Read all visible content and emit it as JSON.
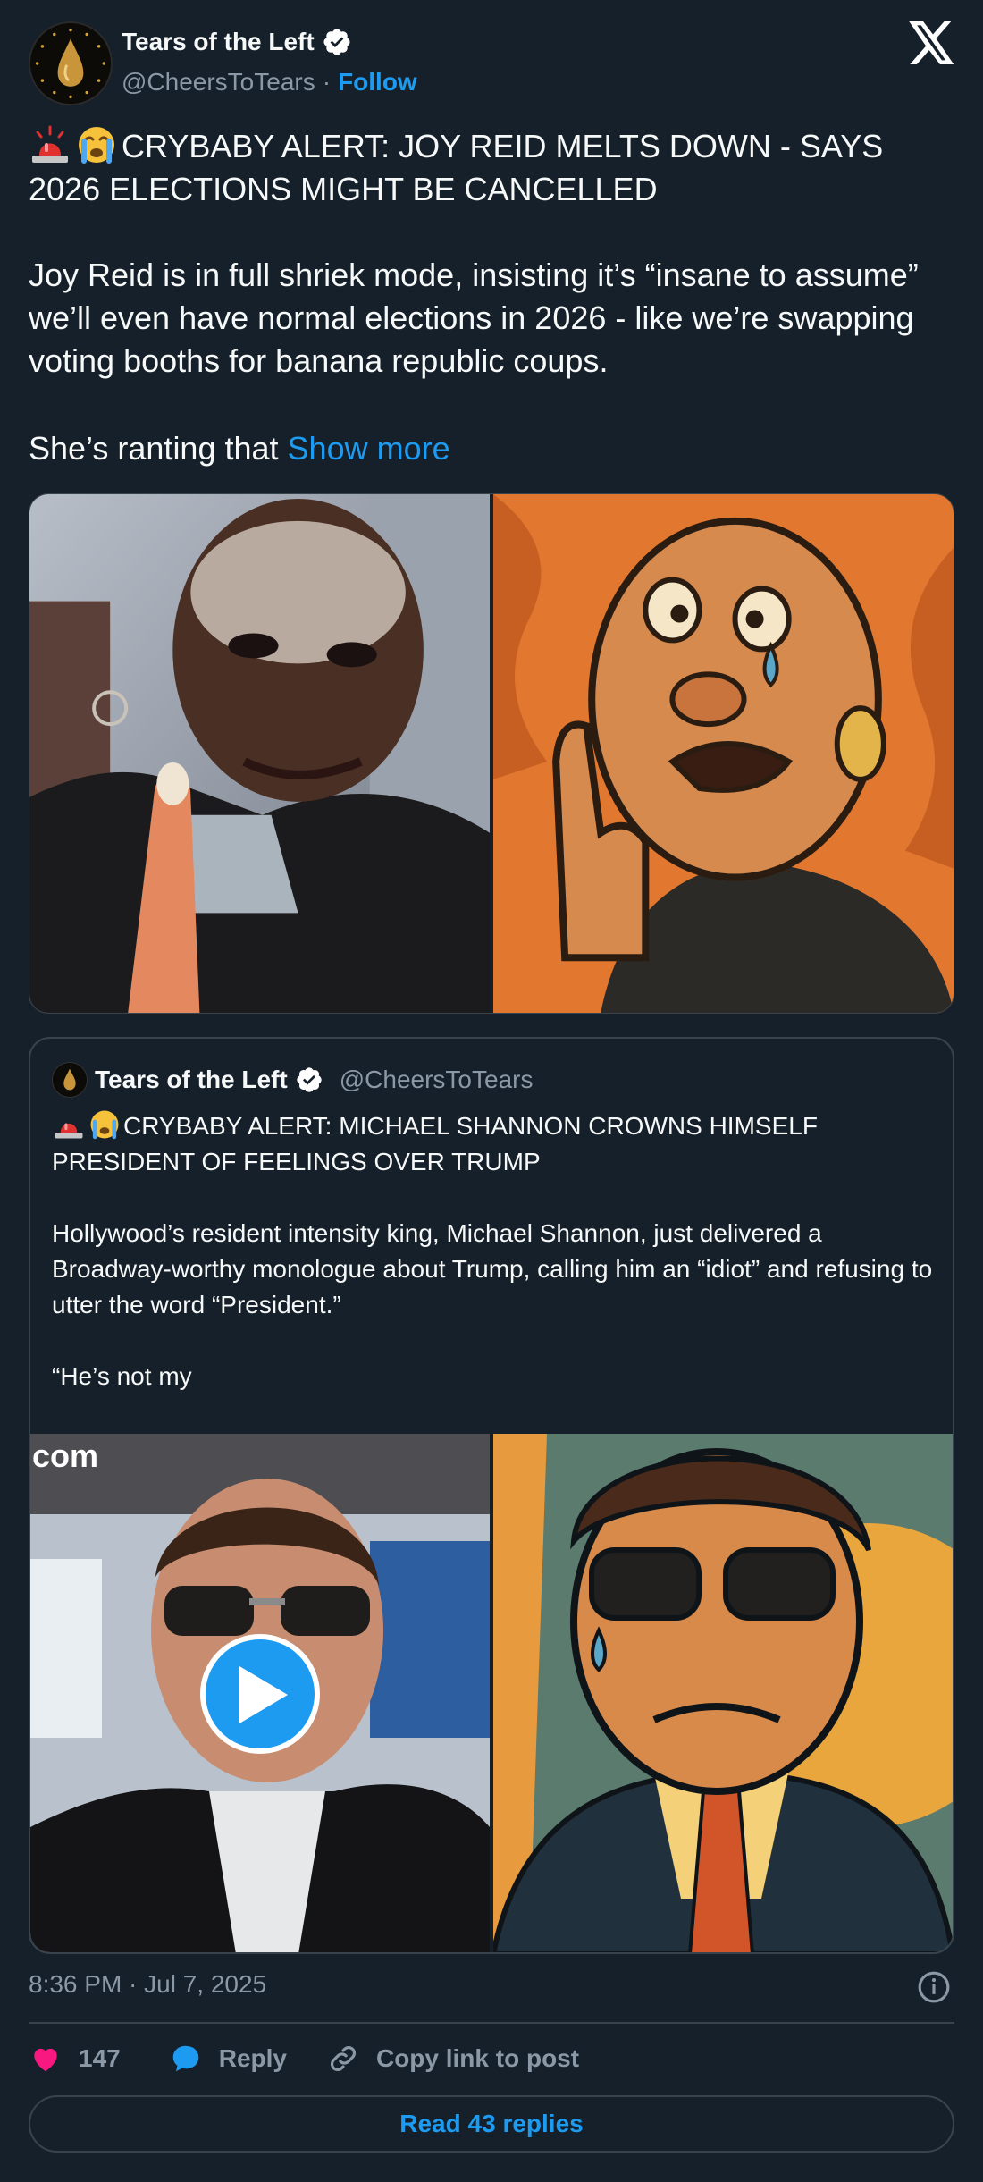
{
  "author": {
    "name": "Tears of the Left",
    "handle": "@CheersToTears",
    "separator": "·",
    "follow_label": "Follow"
  },
  "post": {
    "headline": "CRYBABY ALERT: JOY REID MELTS DOWN  -  SAYS 2026 ELECTIONS MIGHT BE CANCELLED",
    "paragraph1": "Joy Reid is in full shriek mode, insisting it’s “insane to assume” we’ll even have normal elections in 2026 - like we’re swapping voting booths for banana republic coups.",
    "paragraph2": "She’s ranting that ",
    "show_more_label": "Show more"
  },
  "quote": {
    "name": "Tears of the Left",
    "handle": "@CheersToTears",
    "headline": "CRYBABY ALERT: MICHAEL SHANNON CROWNS HIMSELF PRESIDENT OF FEELINGS OVER TRUMP",
    "paragraph1": "Hollywood’s resident intensity king, Michael Shannon, just delivered a Broadway-worthy monologue about Trump, calling him an “idiot” and refusing to utter the word “President.”",
    "paragraph2": "“He’s not my",
    "watermark": "com"
  },
  "footer": {
    "timestamp": "8:36 PM · Jul 7, 2025",
    "likes": "147",
    "reply_label": "Reply",
    "copy_link_label": "Copy link to post",
    "read_replies_label": "Read 43 replies"
  },
  "icons": {
    "siren": "police-siren-icon",
    "crying": "loudly-crying-face-icon",
    "verified": "verified-badge-icon",
    "x": "x-logo-icon",
    "heart": "heart-icon",
    "reply": "speech-bubble-icon",
    "link": "link-icon",
    "info": "info-icon",
    "play": "play-icon"
  },
  "colors": {
    "background": "#15202b",
    "accent": "#1d9bf0",
    "heart": "#f91880",
    "muted": "#8b98a5",
    "border": "#38444d"
  }
}
